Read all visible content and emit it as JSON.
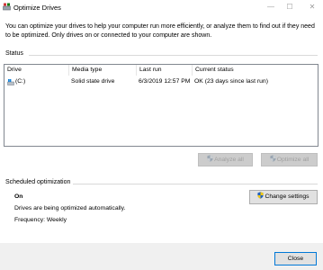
{
  "window": {
    "title": "Optimize Drives",
    "icon": "optimize-drives-icon",
    "controls": [
      "minimize",
      "maximize",
      "close"
    ]
  },
  "intro_text": "You can optimize your drives to help your computer run more efficiently, or analyze them to find out if they need to be optimized. Only drives on or connected to your computer are shown.",
  "status_section": {
    "label": "Status",
    "columns": [
      "Drive",
      "Media type",
      "Last run",
      "Current status"
    ],
    "rows": [
      {
        "drive": "(C:)",
        "drive_icon": "windows-drive-icon",
        "media_type": "Solid state drive",
        "last_run": "6/3/2019 12:57 PM",
        "current_status": "OK (23 days since last run)"
      }
    ],
    "analyze_label": "Analyze all",
    "optimize_label": "Optimize all"
  },
  "scheduled_section": {
    "label": "Scheduled optimization",
    "state": "On",
    "description": "Drives are being optimized automatically.",
    "frequency": "Frequency: Weekly",
    "change_settings_label": "Change settings"
  },
  "footer": {
    "close_label": "Close"
  },
  "colors": {
    "accent_blue": "#0078d7",
    "button_face": "#e1e1e1",
    "disabled_button_face": "#cccccc",
    "footer_background": "#f0f0f0"
  }
}
